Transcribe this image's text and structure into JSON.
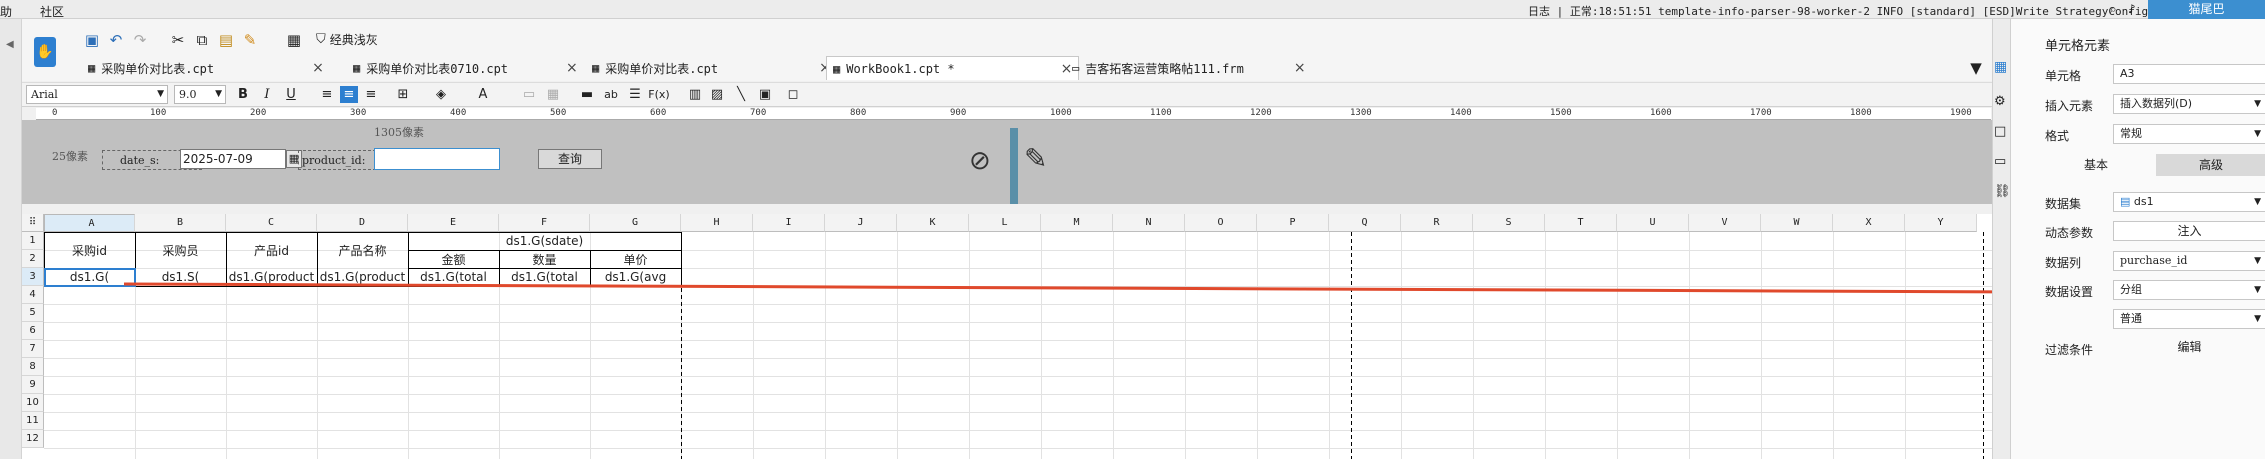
{
  "menu": {
    "items": [
      "助",
      "社区"
    ]
  },
  "status": {
    "text": "日志 | 正常:18:51:51 template-info-parser-98-worker-2 INFO [standard] [ESD]Write StrategyConfigsA...",
    "user": "猫尾巴"
  },
  "toolbar": {
    "classic_label": "经典浅灰"
  },
  "tabs": [
    {
      "label": "采购单价对比表.cpt"
    },
    {
      "label": "采购单价对比表0710.cpt"
    },
    {
      "label": "采购单价对比表.cpt"
    },
    {
      "label": "WorkBook1.cpt *"
    },
    {
      "label": "吉客拓客运营策略帖111.frm"
    }
  ],
  "format": {
    "font": "Arial",
    "size": "9.0"
  },
  "ruler": {
    "ticks": [
      "0",
      "100",
      "200",
      "300",
      "400",
      "500",
      "600",
      "700",
      "800",
      "900",
      "1000",
      "1100",
      "1200",
      "1300",
      "1400",
      "1500",
      "1600",
      "1700",
      "1800",
      "1900"
    ]
  },
  "params": {
    "px_label": "1305像素",
    "left_px_label": "25像素",
    "date_label": "date_s:",
    "date_value": "2025-07-09",
    "product_label": "product_id:",
    "product_value": "",
    "query_label": "查询"
  },
  "grid": {
    "columns": [
      "A",
      "B",
      "C",
      "D",
      "E",
      "F",
      "G",
      "H",
      "I",
      "J",
      "K",
      "L",
      "M",
      "N",
      "O",
      "P",
      "Q",
      "R",
      "S",
      "T",
      "U",
      "V",
      "W",
      "X",
      "Y"
    ],
    "rows": [
      "1",
      "2",
      "3",
      "4",
      "5",
      "6",
      "7",
      "8",
      "9",
      "10",
      "11",
      "12"
    ],
    "cells": {
      "a1": "采购id",
      "b1": "采购员",
      "c1": "产品id",
      "d1": "产品名称",
      "efg1": "ds1.G(sdate)",
      "e2": "金额",
      "f2": "数量",
      "g2": "单价",
      "a3": "ds1.G(",
      "b3": "ds1.S(",
      "c3": "ds1.G(product",
      "d3": "ds1.G(product",
      "e3": "ds1.G(total",
      "f3": "ds1.G(total",
      "g3": "ds1.G(avg"
    }
  },
  "panel": {
    "title": "单元格元素",
    "cell_label": "单元格",
    "cell_value": "A3",
    "insert_label": "插入元素",
    "insert_value": "插入数据列(D)",
    "format_label": "格式",
    "format_value": "常规",
    "tab_basic": "基本",
    "tab_advanced": "高级",
    "dataset_label": "数据集",
    "dataset_value": "ds1",
    "dynparam_label": "动态参数",
    "dynparam_btn": "注入",
    "datacol_label": "数据列",
    "datacol_value": "purchase_id",
    "datasetting_label": "数据设置",
    "datasetting_value": "分组",
    "mode_value": "普通",
    "filter_label": "过滤条件",
    "filter_btn": "编辑"
  },
  "colors": {
    "accent": "#3c8fd0",
    "arrow": "#e0492c",
    "param_bg": "#c0c0c0"
  }
}
